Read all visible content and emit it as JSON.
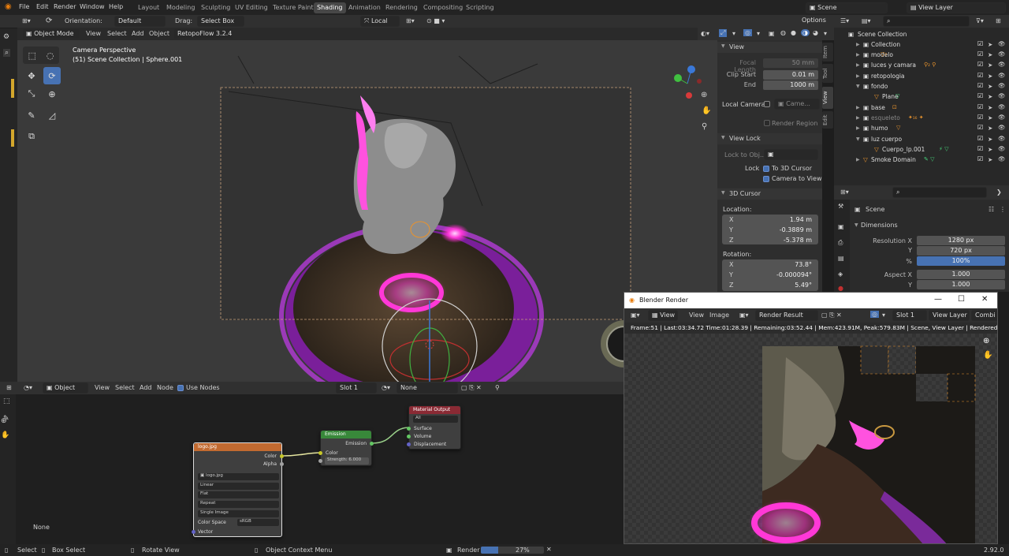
{
  "menubar": {
    "items": [
      "File",
      "Edit",
      "Render",
      "Window",
      "Help"
    ],
    "workspaces": [
      "Layout",
      "Modeling",
      "Sculpting",
      "UV Editing",
      "Texture Paint",
      "Shading",
      "Animation",
      "Rendering",
      "Compositing",
      "Scripting"
    ],
    "active_workspace": "Shading",
    "scene_label": "Scene",
    "view_layer_label": "View Layer"
  },
  "tool_settings": {
    "orientation_label": "Orientation:",
    "orientation_value": "Default",
    "drag_label": "Drag:",
    "drag_value": "Select Box",
    "transform_value": "Local",
    "options_label": "Options"
  },
  "viewport_header": {
    "mode": "Object Mode",
    "menus": [
      "View",
      "Select",
      "Add",
      "Object"
    ],
    "addon": "RetopoFlow 3.2.4"
  },
  "viewport": {
    "camera_title": "Camera Perspective",
    "collection_info": "(51) Scene Collection | Sphere.001"
  },
  "sidebar_tabs": [
    "Item",
    "Tool",
    "View",
    "Edit"
  ],
  "view_panel": {
    "title": "View",
    "focal_length_label": "Focal Length",
    "focal_length_value": "50 mm",
    "clip_start_label": "Clip Start",
    "clip_start_value": "0.01 m",
    "end_label": "End",
    "end_value": "1000 m",
    "local_camera_label": "Local Camera",
    "local_camera_value": "Came...",
    "render_region_label": "Render Region",
    "view_lock_title": "View Lock",
    "lock_to_obj_label": "Lock to Obj...",
    "lock_label": "Lock",
    "lock_3d_cursor": "To 3D Cursor",
    "camera_to_view": "Camera to View"
  },
  "cursor_panel": {
    "title": "3D Cursor",
    "location_label": "Location:",
    "loc_x_label": "X",
    "loc_x": "1.94 m",
    "loc_y_label": "Y",
    "loc_y": "-0.3889 m",
    "loc_z_label": "Z",
    "loc_z": "-5.378 m",
    "rotation_label": "Rotation:",
    "rot_x_label": "X",
    "rot_x": "73.8°",
    "rot_y_label": "Y",
    "rot_y": "-0.000094°",
    "rot_z_label": "Z",
    "rot_z": "5.49°"
  },
  "outliner": {
    "root": "Scene Collection",
    "items": [
      {
        "name": "Collection",
        "depth": 1
      },
      {
        "name": "modelo",
        "depth": 1
      },
      {
        "name": "luces y camara",
        "depth": 1
      },
      {
        "name": "retopologia",
        "depth": 1
      },
      {
        "name": "fondo",
        "depth": 1
      },
      {
        "name": "Plane",
        "depth": 2
      },
      {
        "name": "base",
        "depth": 1
      },
      {
        "name": "esqueleto",
        "depth": 1
      },
      {
        "name": "humo",
        "depth": 1
      },
      {
        "name": "luz cuerpo",
        "depth": 1
      },
      {
        "name": "Cuerpo_lp.001",
        "depth": 2
      },
      {
        "name": "Smoke Domain",
        "depth": 1
      }
    ]
  },
  "properties": {
    "scene_label": "Scene",
    "dimensions_title": "Dimensions",
    "res_x_label": "Resolution X",
    "res_x": "1280 px",
    "res_y_label": "Y",
    "res_y": "720 px",
    "percent_label": "%",
    "percent": "100%",
    "aspect_x_label": "Aspect X",
    "aspect_x": "1.000",
    "aspect_y_label": "Y",
    "aspect_y": "1.000"
  },
  "node_editor": {
    "type": "Object",
    "menus": [
      "View",
      "Select",
      "Add",
      "Node"
    ],
    "use_nodes": "Use Nodes",
    "slot": "Slot 1",
    "material": "None",
    "none_label": "None",
    "image_node": {
      "title": "logo.jpg",
      "out_color": "Color",
      "out_alpha": "Alpha",
      "image_name": "logo.jpg",
      "interpolation": "Linear",
      "projection": "Flat",
      "extension": "Repeat",
      "source": "Single Image",
      "colorspace_label": "Color Space",
      "colorspace_value": "sRGB",
      "vector": "Vector"
    },
    "emission_node": {
      "title": "Emission",
      "out": "Emission",
      "in_color": "Color",
      "strength_label": "Strength:",
      "strength_value": "6.000"
    },
    "output_node": {
      "title": "Material Output",
      "target": "All",
      "surface": "Surface",
      "volume": "Volume",
      "displacement": "Displacement"
    }
  },
  "render_window": {
    "title": "Blender Render",
    "menus": [
      "View",
      "View",
      "Image"
    ],
    "result": "Render Result",
    "slot": "Slot 1",
    "view_layer": "View Layer",
    "combined": "Combi",
    "stats": "Frame:51 | Last:03:34.72 Time:01:28.39 | Remaining:03:52.44 | Mem:423.91M, Peak:579.83M | Scene, View Layer | Rendered 60/240 Tile"
  },
  "statusbar": {
    "select": "Select",
    "box_select": "Box Select",
    "rotate_view": "Rotate View",
    "context_menu": "Object Context Menu",
    "render_label": "Render",
    "render_progress": 0.27,
    "render_percent": "27%",
    "version": "2.92.0"
  }
}
